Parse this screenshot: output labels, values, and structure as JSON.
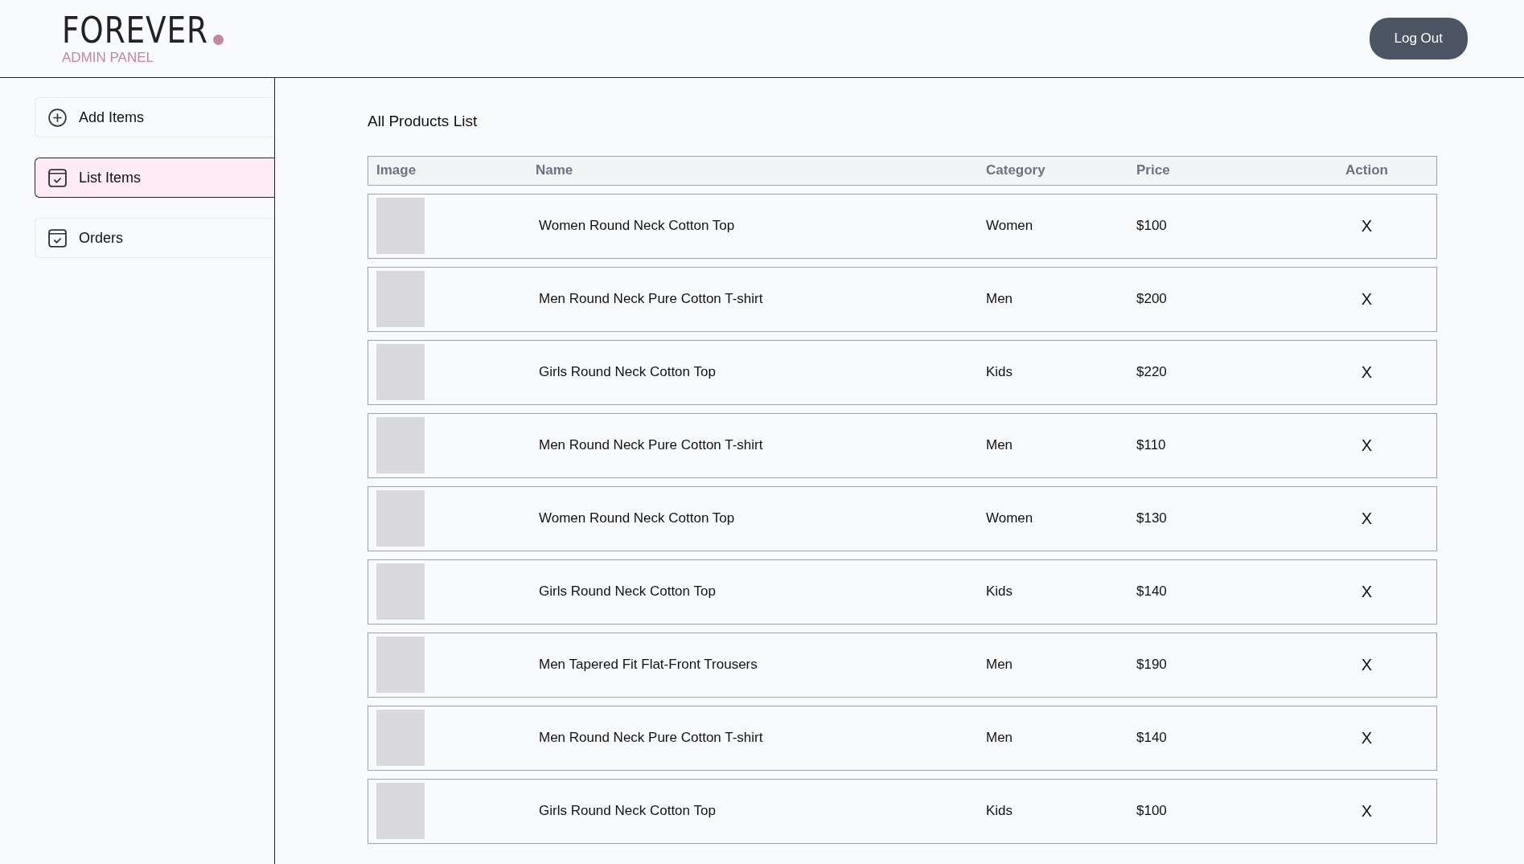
{
  "header": {
    "logo": "FOREVER",
    "subtitle": "ADMIN PANEL",
    "logout_button": "Log Out"
  },
  "sidebar": {
    "items": [
      {
        "label": "Add Items",
        "kind": "add",
        "selected": false
      },
      {
        "label": "List Items",
        "kind": "list",
        "selected": true
      },
      {
        "label": "Orders",
        "kind": "orders",
        "selected": false
      }
    ]
  },
  "main": {
    "title": "All Products List",
    "table": {
      "columns": [
        "Image",
        "Name",
        "Category",
        "Price",
        "Action"
      ],
      "rows": [
        {
          "name": "Women Round Neck Cotton Top",
          "category": "Women",
          "price": "$100",
          "action": "X"
        },
        {
          "name": "Men Round Neck Pure Cotton T-shirt",
          "category": "Men",
          "price": "$200",
          "action": "X"
        },
        {
          "name": "Girls Round Neck Cotton Top",
          "category": "Kids",
          "price": "$220",
          "action": "X"
        },
        {
          "name": "Men Round Neck Pure Cotton T-shirt",
          "category": "Men",
          "price": "$110",
          "action": "X"
        },
        {
          "name": "Women Round Neck Cotton Top",
          "category": "Women",
          "price": "$130",
          "action": "X"
        },
        {
          "name": "Girls Round Neck Cotton Top",
          "category": "Kids",
          "price": "$140",
          "action": "X"
        },
        {
          "name": "Men Tapered Fit Flat-Front Trousers",
          "category": "Men",
          "price": "$190",
          "action": "X"
        },
        {
          "name": "Men Round Neck Pure Cotton T-shirt",
          "category": "Men",
          "price": "$140",
          "action": "X"
        },
        {
          "name": "Girls Round Neck Cotton Top",
          "category": "Kids",
          "price": "$100",
          "action": "X"
        }
      ]
    }
  }
}
